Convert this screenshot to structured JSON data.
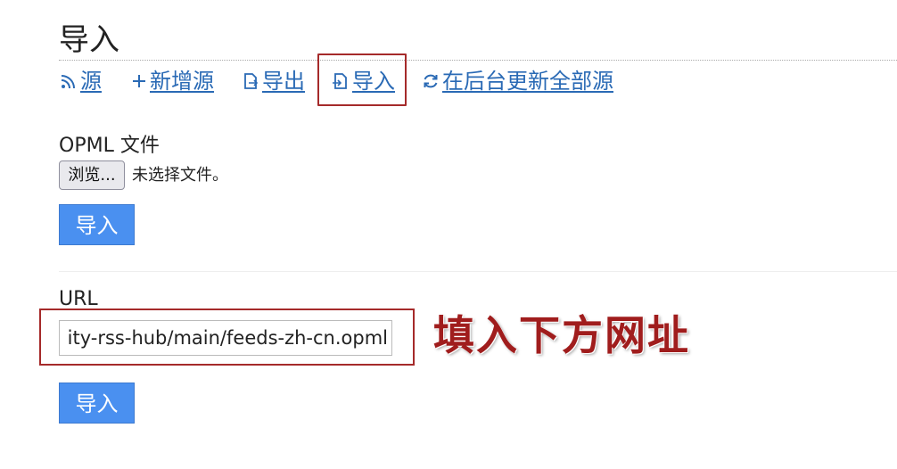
{
  "page": {
    "title": "导入"
  },
  "nav": {
    "items": [
      {
        "label": "源",
        "icon": "rss-icon"
      },
      {
        "label": "新增源",
        "icon": "plus-icon"
      },
      {
        "label": "导出",
        "icon": "file-export-icon"
      },
      {
        "label": "导入",
        "icon": "file-import-icon"
      },
      {
        "label": "在后台更新全部源",
        "icon": "refresh-icon"
      }
    ]
  },
  "opml": {
    "label": "OPML 文件",
    "browse_label": "浏览...",
    "no_file_text": "未选择文件。",
    "submit_label": "导入"
  },
  "url_section": {
    "label": "URL",
    "input_value": "ity-rss-hub/main/feeds-zh-cn.opml",
    "submit_label": "导入"
  },
  "annotation": {
    "text": "填入下方网址"
  },
  "colors": {
    "link": "#2a6ab5",
    "button": "#4a90f0",
    "highlight_border": "#a52a2a",
    "annotation_text": "#a01d1d"
  }
}
